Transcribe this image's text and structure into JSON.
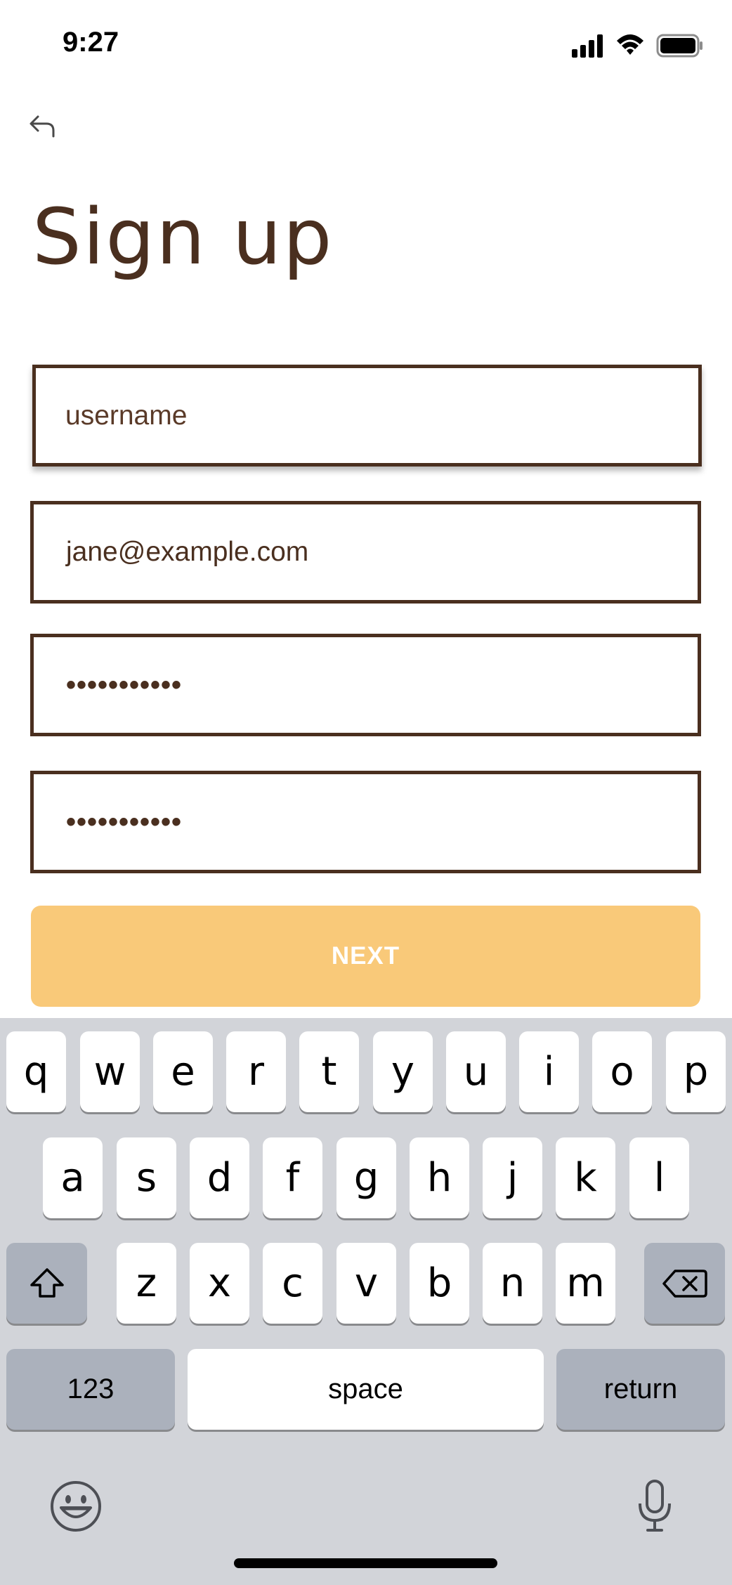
{
  "status_bar": {
    "time": "9:27"
  },
  "header": {
    "title": "Sign up"
  },
  "form": {
    "username_placeholder": "username",
    "email_value": "jane@example.com",
    "password_mask": "•••••••••••",
    "confirm_password_mask": "•••••••••••",
    "next_label": "NEXT"
  },
  "colors": {
    "brand_brown": "#4a2f1f",
    "button_fill": "#f9c979",
    "keyboard_bg": "#d2d4d9"
  },
  "keyboard": {
    "row1": [
      "q",
      "w",
      "e",
      "r",
      "t",
      "y",
      "u",
      "i",
      "o",
      "p"
    ],
    "row2": [
      "a",
      "s",
      "d",
      "f",
      "g",
      "h",
      "j",
      "k",
      "l"
    ],
    "row3": [
      "z",
      "x",
      "c",
      "v",
      "b",
      "n",
      "m"
    ],
    "numbers_label": "123",
    "space_label": "space",
    "return_label": "return"
  },
  "icons": [
    "back-arrow-icon",
    "signal-icon",
    "wifi-icon",
    "battery-icon",
    "shift-icon",
    "backspace-icon",
    "emoji-icon",
    "microphone-icon"
  ]
}
